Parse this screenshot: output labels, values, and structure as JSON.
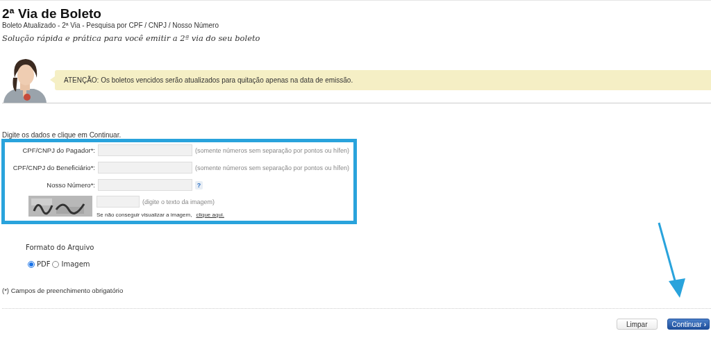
{
  "header": {
    "title": "2ª Via de Boleto",
    "breadcrumb": "Boleto Atualizado - 2ª Via - Pesquisa por CPF / CNPJ / Nosso Número",
    "tagline": "Solução rápida e prática para você emitir a 2ª via do seu boleto"
  },
  "notice": {
    "text": "ATENÇÃO: Os boletos vencidos serão atualizados para quitação apenas na data de emissão."
  },
  "instructions": "Digite os dados e clique em Continuar.",
  "fields": [
    {
      "kind": "text",
      "label": "CPF/CNPJ do Pagador*:",
      "hint": "(somente números sem separação por pontos ou hífen)"
    },
    {
      "kind": "text",
      "label": "CPF/CNPJ do Beneficiário*:",
      "hint": "(somente números sem separação por pontos ou hífen)"
    },
    {
      "kind": "help",
      "label": "Nosso Número*:",
      "help": "?"
    },
    {
      "kind": "captcha",
      "hint": "(digite o texto da imagem)",
      "note": "Se não conseguir visualizar a imagem,",
      "link": "clique aqui."
    }
  ],
  "format": {
    "title": "Formato do Arquivo",
    "options": [
      {
        "label": "PDF",
        "selected": true
      },
      {
        "label": "Imagem",
        "selected": false
      }
    ]
  },
  "required_note": "(*) Campos de preenchimento obrigatório",
  "buttons": [
    {
      "kind": "plain",
      "label": "Limpar"
    },
    {
      "kind": "primary",
      "label": "Continuar",
      "arrow": "›"
    }
  ]
}
